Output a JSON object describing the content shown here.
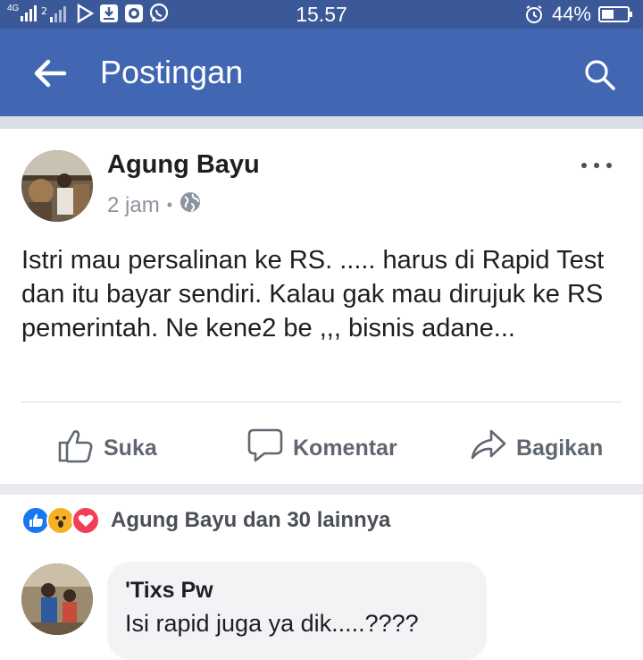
{
  "status_bar": {
    "network_label": "4G",
    "time": "15.57",
    "battery": "44%"
  },
  "app_bar": {
    "title": "Postingan"
  },
  "post": {
    "author": "Agung Bayu",
    "time": "2 jam",
    "separator": "•",
    "text": "Istri mau persalinan ke RS. ..... harus di Rapid Test dan itu bayar sendiri. Kalau gak mau dirujuk ke RS pemerintah. Ne kene2 be ,,, bisnis adane...",
    "actions": {
      "like": "Suka",
      "comment": "Komentar",
      "share": "Bagikan"
    }
  },
  "reactions": {
    "summary": "Agung Bayu dan 30 lainnya",
    "icons": [
      "like-icon",
      "wow-icon",
      "love-icon"
    ]
  },
  "comments": [
    {
      "name": "'Tixs Pw",
      "text": "Isi rapid juga ya dik.....????"
    }
  ],
  "colors": {
    "status_bar": "#3b5998",
    "app_bar": "#4267b2",
    "like_blue": "#1877f2",
    "love_red": "#f33e58",
    "wow_yellow": "#f7b125"
  }
}
